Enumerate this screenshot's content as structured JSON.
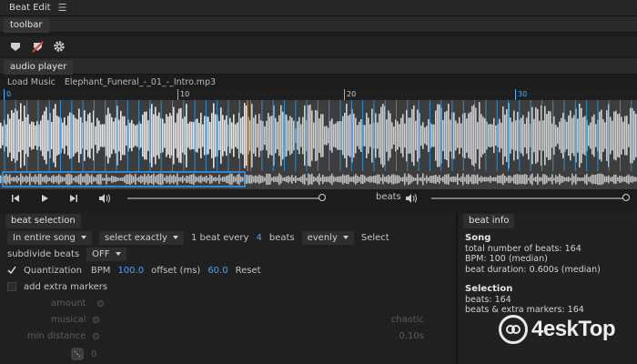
{
  "window": {
    "title": "Beat Edit",
    "menu_icon": "hamburger-menu-icon"
  },
  "toolbar": {
    "tab": "toolbar",
    "tools": [
      "marker-icon",
      "no-marker-icon",
      "gear-icon"
    ]
  },
  "audio_player": {
    "tab": "audio player",
    "load_music": "Load Music",
    "filename": "Elephant_Funeral_-_01_-_Intro.mp3",
    "ruler": [
      "0",
      "10",
      "20",
      "30"
    ],
    "beats_label": "beats",
    "position_slider": 1.0,
    "beats_volume_slider": 1.0
  },
  "beat_selection": {
    "tab": "beat selection",
    "scope": "In entire song",
    "mode": "select exactly",
    "one_beat_every": "1 beat every",
    "every_value": "4",
    "beats": "beats",
    "spacing": "evenly",
    "select_button": "Select",
    "subdivide_label": "subdivide beats",
    "subdivide_value": "OFF",
    "quantization_label": "Quantization",
    "quantization_checked": true,
    "bpm_label": "BPM",
    "bpm_value": "100.0",
    "offset_label": "offset (ms)",
    "offset_value": "60.0",
    "reset_button": "Reset",
    "extra_markers_label": "add extra markers",
    "amount_label": "amount",
    "musical_label": "musical",
    "chaotic_label": "chaotic",
    "min_distance_label": "min distance",
    "min_distance_value": "0.10s",
    "seed_value": "0"
  },
  "beat_info": {
    "tab": "beat info",
    "song_heading": "Song",
    "total_beats": "total number of beats: 164",
    "bpm": "BPM: 100 (median)",
    "beat_duration": "beat duration: 0.600s (median)",
    "selection_heading": "Selection",
    "sel_beats": "beats: 164",
    "sel_beats_extra": "beats & extra markers: 164"
  },
  "watermark": {
    "text": "4eskTop"
  },
  "colors": {
    "accent": "#40a6ff",
    "bg": "#1c1c1c",
    "panel": "#2a2a2a",
    "waveform": "#d9d9d9"
  }
}
